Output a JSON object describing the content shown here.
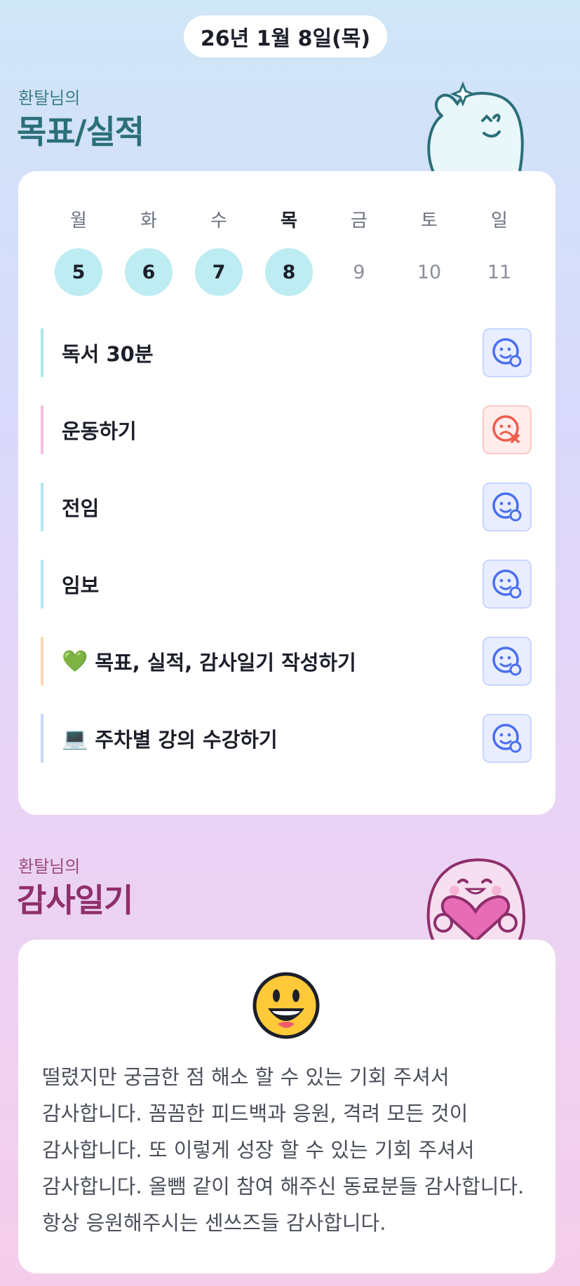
{
  "header": {
    "date": "26년 1월 8일(목)"
  },
  "goals_section": {
    "subtitle": "환탈님의",
    "title": "목표/실적"
  },
  "week": {
    "days": [
      {
        "dow": "월",
        "date": "5",
        "done": true,
        "today": false
      },
      {
        "dow": "화",
        "date": "6",
        "done": true,
        "today": false
      },
      {
        "dow": "수",
        "date": "7",
        "done": true,
        "today": false
      },
      {
        "dow": "목",
        "date": "8",
        "done": true,
        "today": true
      },
      {
        "dow": "금",
        "date": "9",
        "done": false,
        "today": false
      },
      {
        "dow": "토",
        "date": "10",
        "done": false,
        "today": false
      },
      {
        "dow": "일",
        "date": "11",
        "done": false,
        "today": false
      }
    ]
  },
  "goals": [
    {
      "label": "독서 30분",
      "emoji": "",
      "status": "achieved",
      "bar_color": "#a8e8e4"
    },
    {
      "label": "운동하기",
      "emoji": "",
      "status": "missed",
      "bar_color": "#f6bfe0"
    },
    {
      "label": "전임",
      "emoji": "",
      "status": "achieved",
      "bar_color": "#b3e6f4"
    },
    {
      "label": "임보",
      "emoji": "",
      "status": "achieved",
      "bar_color": "#b3e6f4"
    },
    {
      "label": "목표, 실적, 감사일기 작성하기",
      "emoji": "💚",
      "status": "achieved",
      "bar_color": "#fbd7b4"
    },
    {
      "label": "주차별 강의 수강하기",
      "emoji": "💻",
      "status": "achieved",
      "bar_color": "#c9d6f7"
    }
  ],
  "thanks_section": {
    "subtitle": "환탈님의",
    "title": "감사일기"
  },
  "thanks": {
    "mood_icon": "grinning-face-icon",
    "text": "떨렸지만 궁금한 점 해소 할 수 있는 기회 주셔서 감사합니다. 꼼꼼한 피드백과 응원, 격려 모든 것이 감사합니다. 또 이렇게 성장 할 수 있는 기회 주셔서 감사합니다. 올뺌 같이 참여 해주신 동료분들 감사합니다. 항상 응원해주시는 센쓰즈들 감사합니다."
  },
  "colors": {
    "done_date": "#bdecf2",
    "achieved_icon": "#4a6ef0",
    "missed_icon": "#ef5b4c"
  }
}
